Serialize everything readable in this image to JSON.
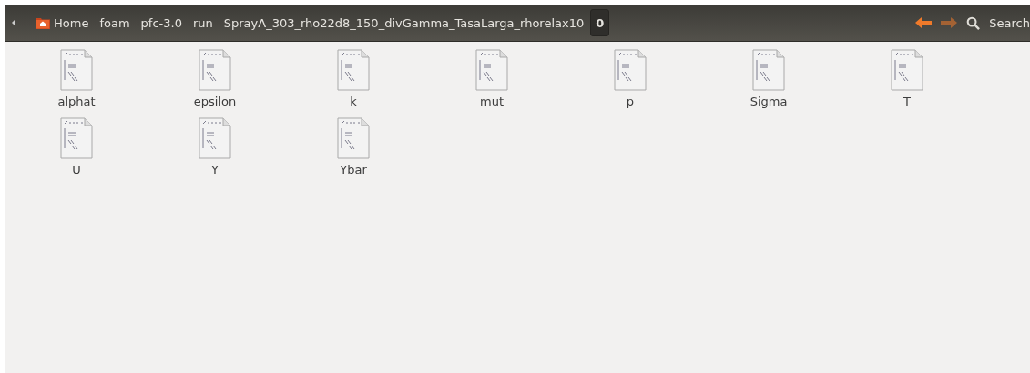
{
  "toolbar": {
    "breadcrumbs": [
      {
        "label": "Home",
        "kind": "home",
        "selected": false
      },
      {
        "label": "foam",
        "kind": "folder",
        "selected": false
      },
      {
        "label": "pfc-3.0",
        "kind": "folder",
        "selected": false
      },
      {
        "label": "run",
        "kind": "folder",
        "selected": false
      },
      {
        "label": "SprayA_303_rho22d8_150_divGamma_TasaLarga_rhorelax10",
        "kind": "folder",
        "selected": false
      },
      {
        "label": "0",
        "kind": "folder",
        "selected": true
      }
    ],
    "back_disabled": false,
    "forward_disabled": true,
    "search_label": "Search"
  },
  "files": [
    {
      "name": "alphat"
    },
    {
      "name": "epsilon"
    },
    {
      "name": "k"
    },
    {
      "name": "mut"
    },
    {
      "name": "p"
    },
    {
      "name": "Sigma"
    },
    {
      "name": "T"
    },
    {
      "name": "U"
    },
    {
      "name": "Y"
    },
    {
      "name": "Ybar"
    }
  ]
}
